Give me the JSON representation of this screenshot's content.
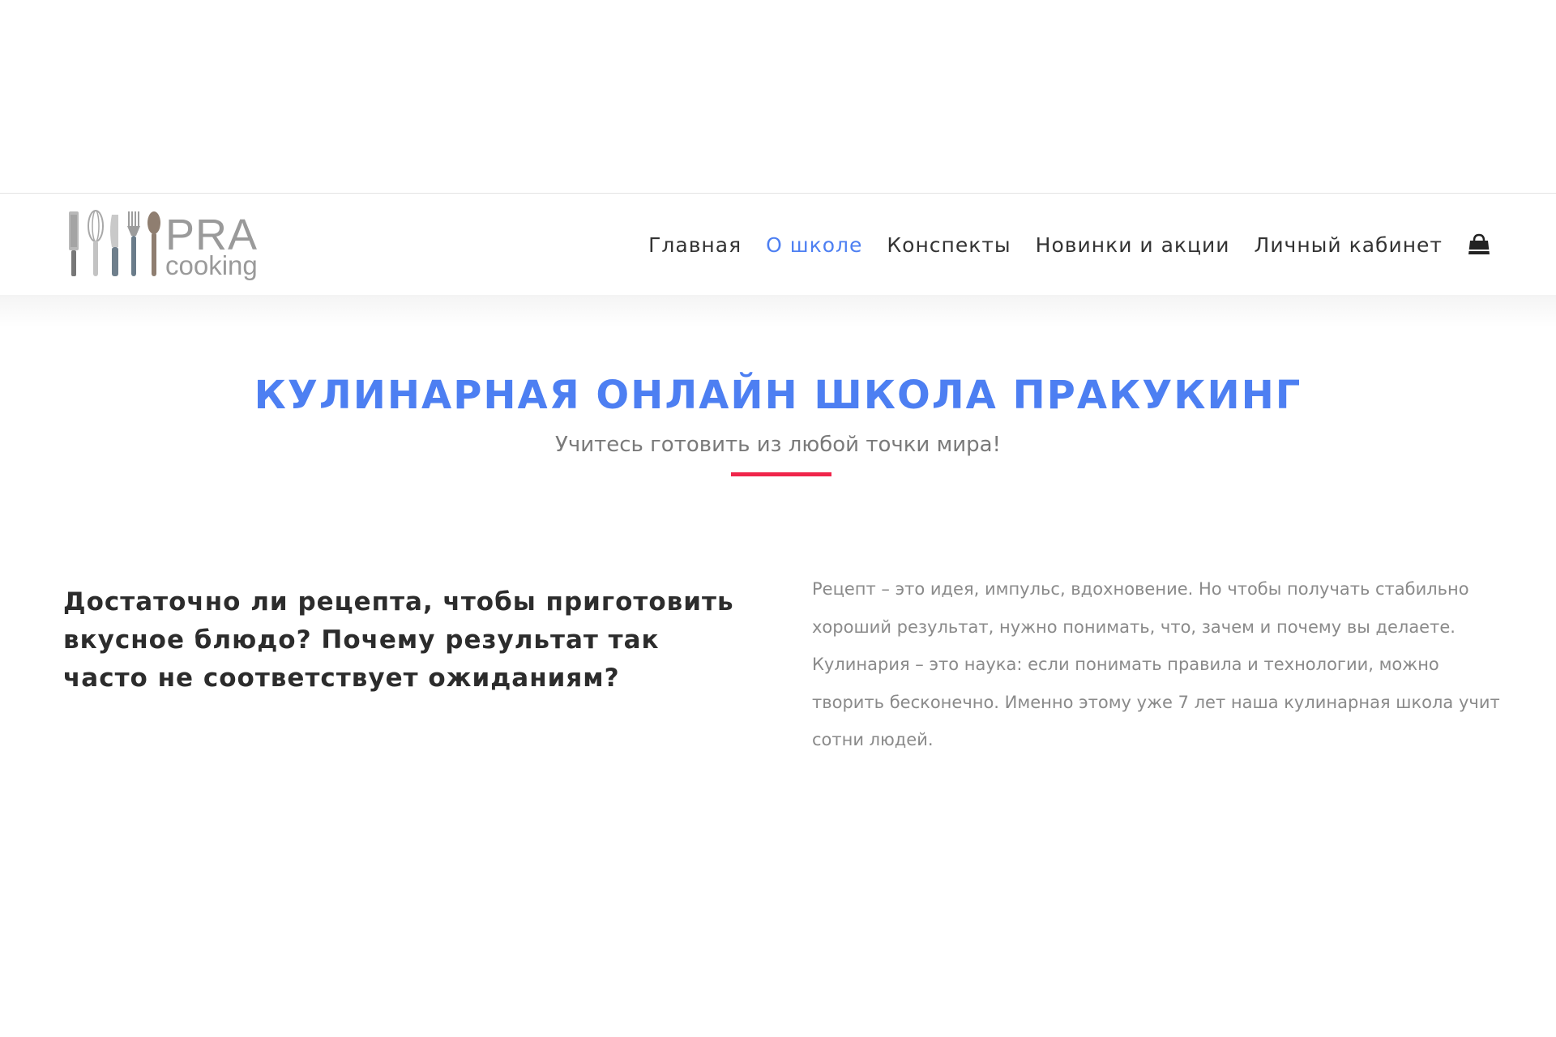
{
  "logo": {
    "word1": "PRA",
    "word2": "cooking"
  },
  "nav": {
    "items": [
      {
        "label": "Главная",
        "active": false
      },
      {
        "label": "О школе",
        "active": true
      },
      {
        "label": "Конспекты",
        "active": false
      },
      {
        "label": "Новинки и акции",
        "active": false
      },
      {
        "label": "Личный кабинет",
        "active": false
      }
    ],
    "cart_icon": "shopping-bag-icon"
  },
  "hero": {
    "title": "КУЛИНАРНАЯ ОНЛАЙН ШКОЛА ПРАКУКИНГ",
    "subtitle": "Учитесь готовить из любой точки мира!"
  },
  "content": {
    "question": "Достаточно ли рецепта, чтобы приготовить вкусное блюдо? Почему результат так часто не соответствует ожиданиям?",
    "paragraph1": "Рецепт – это идея, импульс, вдохновение. Но чтобы получать стабильно хороший результат, нужно понимать, что, зачем и почему вы делаете.",
    "paragraph2": "Кулинария – это наука: если понимать правила и технологии, можно творить бесконечно. Именно этому уже 7 лет наша кулинарная школа учит сотни людей."
  },
  "colors": {
    "accent_blue": "#4d7ff2",
    "divider_red": "#f0254a",
    "text_dark": "#2c2c2c",
    "text_gray": "#8a8a8a"
  }
}
